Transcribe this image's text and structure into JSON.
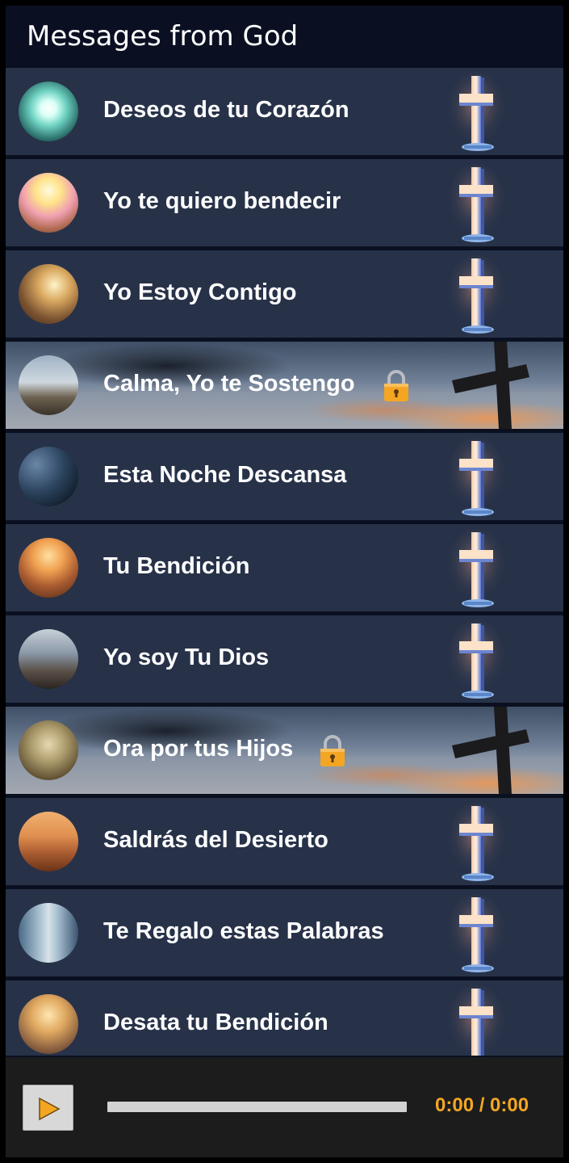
{
  "app": {
    "title": "Messages from God"
  },
  "colors": {
    "header_bg": "#0a1022",
    "row_bg": "#273249",
    "player_bg": "#1c1c1c",
    "accent": "#f4a623",
    "text": "#ffffff"
  },
  "messages": [
    {
      "label": "Deseos de tu Corazón",
      "locked": false,
      "icon": "glowing-cross-icon",
      "thumb": "heart-light"
    },
    {
      "label": "Yo te quiero bendecir",
      "locked": false,
      "icon": "glowing-cross-icon",
      "thumb": "hands-light"
    },
    {
      "label": "Yo Estoy Contigo",
      "locked": false,
      "icon": "glowing-cross-icon",
      "thumb": "jesus-helping"
    },
    {
      "label": "Calma, Yo te Sostengo",
      "locked": true,
      "icon": "dark-cross-sunset-icon",
      "thumb": "jesus-seashore"
    },
    {
      "label": "Esta Noche Descansa",
      "locked": false,
      "icon": "glowing-cross-icon",
      "thumb": "jesus-night"
    },
    {
      "label": "Tu Bendición",
      "locked": false,
      "icon": "glowing-cross-icon",
      "thumb": "hands-sunset"
    },
    {
      "label": "Yo soy Tu Dios",
      "locked": false,
      "icon": "glowing-cross-icon",
      "thumb": "jesus-standing"
    },
    {
      "label": "Ora por tus Hijos",
      "locked": true,
      "icon": "dark-cross-sunset-icon",
      "thumb": "jesus-children"
    },
    {
      "label": "Saldrás del Desierto",
      "locked": false,
      "icon": "glowing-cross-icon",
      "thumb": "desert"
    },
    {
      "label": "Te Regalo estas Palabras",
      "locked": false,
      "icon": "glowing-cross-icon",
      "thumb": "scroll"
    },
    {
      "label": "Desata tu Bendición",
      "locked": false,
      "icon": "glowing-cross-icon",
      "thumb": "jesus-clouds"
    }
  ],
  "player": {
    "time": "0:00 / 0:00",
    "progress": 0,
    "play_icon": "play-icon"
  }
}
